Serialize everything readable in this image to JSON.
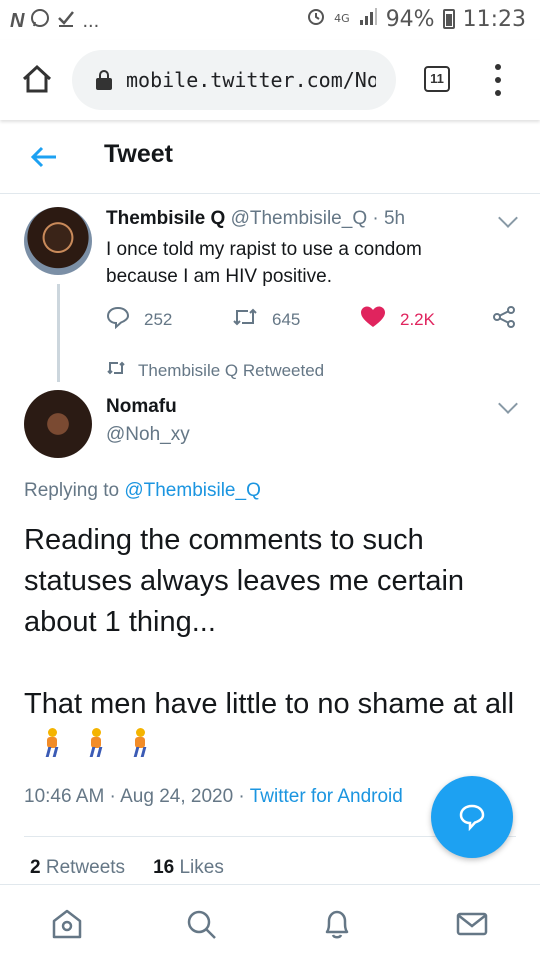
{
  "status_bar": {
    "left_icons": [
      "n-icon",
      "whatsapp-icon",
      "check-icon"
    ],
    "more": "...",
    "network": "4G",
    "battery": "94%",
    "time": "11:23"
  },
  "browser": {
    "url": "mobile.twitter.com/Noh_",
    "tab_count": "11"
  },
  "header": {
    "title": "Tweet"
  },
  "parent_tweet": {
    "name": "Thembisile Q",
    "handle": "@Thembisile_Q",
    "separator": "·",
    "time": "5h",
    "text": "I once told my rapist to use a condom because I am HIV positive.",
    "replies": "252",
    "retweets": "645",
    "likes": "2.2K"
  },
  "retweeted_by": "Thembisile Q Retweeted",
  "tweet": {
    "name": "Nomafu",
    "handle": "@Noh_xy",
    "replying_prefix": "Replying to",
    "replying_to": "@Thembisile_Q",
    "paragraph1": "Reading the comments to such statuses always leaves me certain about 1 thing...",
    "paragraph2": "That men have little to no shame at all",
    "timestamp": "10:46 AM · Aug 24, 2020 · ",
    "source": "Twitter for Android",
    "retweet_count": "2",
    "retweet_label": "Retweets",
    "like_count": "16",
    "like_label": "Likes"
  },
  "colors": {
    "accent": "#1da1f2",
    "link": "#1b95e0",
    "like": "#e0245e",
    "muted": "#657786"
  }
}
